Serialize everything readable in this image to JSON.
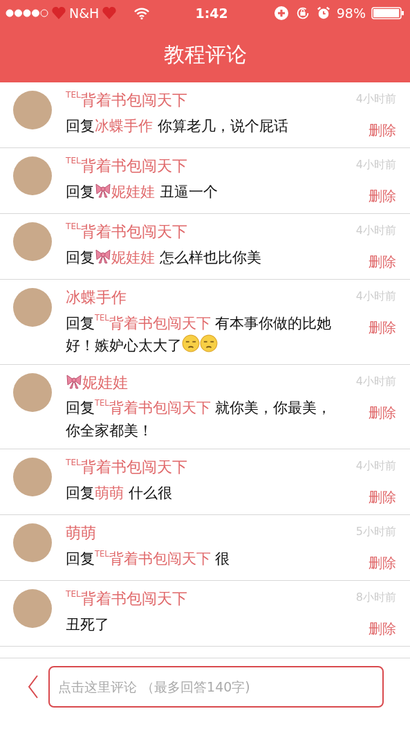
{
  "status_bar": {
    "carrier": "N&H",
    "time": "1:42",
    "battery": "98%"
  },
  "header": {
    "title": "教程评论"
  },
  "comments": [
    {
      "name": [
        {
          "kind": "user",
          "text": "$^{TEL}$背着书包闯天下"
        }
      ],
      "time": "4小时前",
      "action": "删除",
      "body": [
        {
          "kind": "text",
          "text": "回复"
        },
        {
          "kind": "user",
          "text": "冰蝶手作"
        },
        {
          "kind": "text",
          "text": " 你算老几，说个屁话"
        }
      ]
    },
    {
      "name": [
        {
          "kind": "user",
          "text": "$^{TEL}$背着书包闯天下"
        }
      ],
      "time": "4小时前",
      "action": "删除",
      "body": [
        {
          "kind": "text",
          "text": "回复"
        },
        {
          "kind": "bow"
        },
        {
          "kind": "user",
          "text": "妮娃娃"
        },
        {
          "kind": "text",
          "text": " 丑逼一个"
        }
      ]
    },
    {
      "name": [
        {
          "kind": "user",
          "text": "$^{TEL}$背着书包闯天下"
        }
      ],
      "time": "4小时前",
      "action": "删除",
      "body": [
        {
          "kind": "text",
          "text": "回复"
        },
        {
          "kind": "bow"
        },
        {
          "kind": "user",
          "text": "妮娃娃"
        },
        {
          "kind": "text",
          "text": " 怎么样也比你美"
        }
      ]
    },
    {
      "name": [
        {
          "kind": "user",
          "text": "冰蝶手作"
        }
      ],
      "time": "4小时前",
      "action": "删除",
      "body": [
        {
          "kind": "text",
          "text": "回复"
        },
        {
          "kind": "user",
          "text": "$^{TEL}$背着书包闯天下"
        },
        {
          "kind": "text",
          "text": " 有本事你做的比她好！嫉妒心太大了"
        },
        {
          "kind": "unamused"
        },
        {
          "kind": "unamused"
        }
      ]
    },
    {
      "name": [
        {
          "kind": "bow"
        },
        {
          "kind": "user",
          "text": "妮娃娃"
        }
      ],
      "time": "4小时前",
      "action": "删除",
      "body": [
        {
          "kind": "text",
          "text": "回复"
        },
        {
          "kind": "user",
          "text": "$^{TEL}$背着书包闯天下"
        },
        {
          "kind": "text",
          "text": " 就你美，你最美，你全家都美！"
        }
      ]
    },
    {
      "name": [
        {
          "kind": "user",
          "text": "$^{TEL}$背着书包闯天下"
        }
      ],
      "time": "4小时前",
      "action": "删除",
      "body": [
        {
          "kind": "text",
          "text": "回复"
        },
        {
          "kind": "user",
          "text": "萌萌"
        },
        {
          "kind": "text",
          "text": " 什么很"
        }
      ]
    },
    {
      "name": [
        {
          "kind": "user",
          "text": "萌萌"
        }
      ],
      "time": "5小时前",
      "action": "删除",
      "body": [
        {
          "kind": "text",
          "text": "回复"
        },
        {
          "kind": "user",
          "text": "$^{TEL}$背着书包闯天下"
        },
        {
          "kind": "text",
          "text": " 很"
        }
      ]
    },
    {
      "name": [
        {
          "kind": "user",
          "text": "$^{TEL}$背着书包闯天下"
        }
      ],
      "time": "8小时前",
      "action": "删除",
      "body": [
        {
          "kind": "text",
          "text": "丑死了"
        }
      ]
    }
  ],
  "comment_box": {
    "placeholder": "点击这里评论 （最多回答140字)"
  }
}
